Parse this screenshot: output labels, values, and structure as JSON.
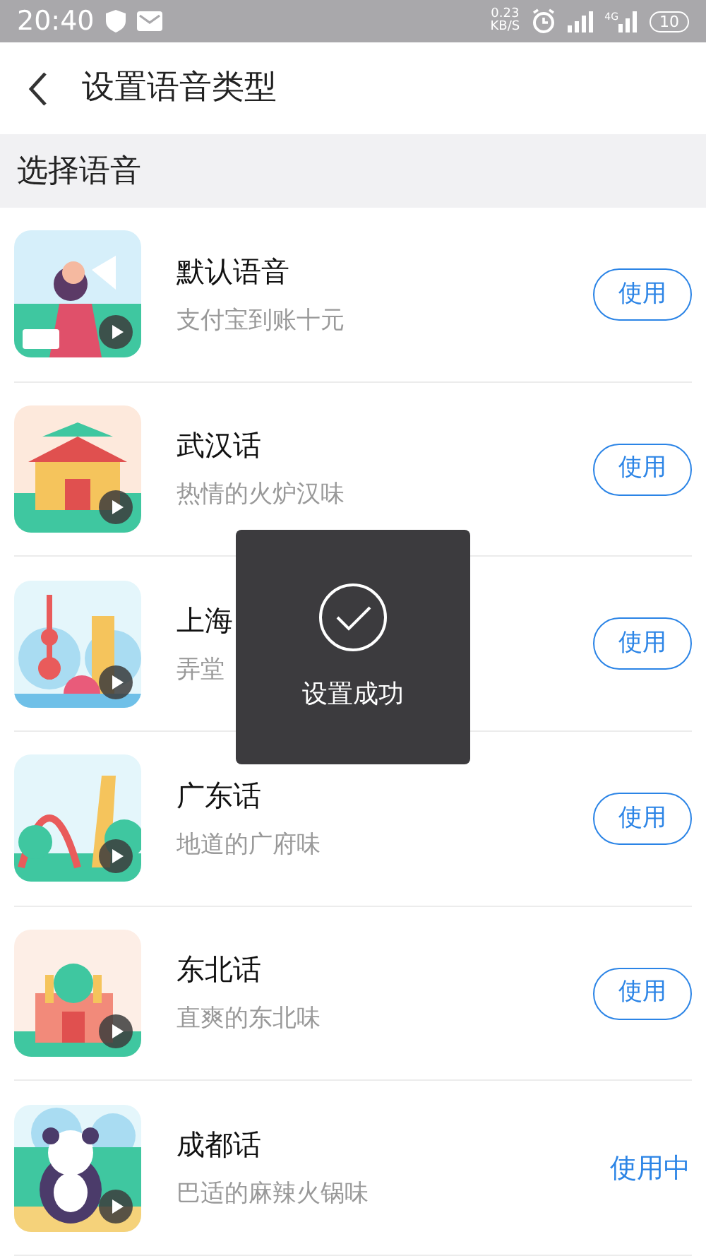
{
  "status_bar": {
    "time": "20:40",
    "net_speed": "0.23",
    "net_unit": "KB/S",
    "network": "4G",
    "battery": "10"
  },
  "header": {
    "title": "设置语音类型"
  },
  "section": {
    "title": "选择语音"
  },
  "voices": [
    {
      "title": "默认语音",
      "subtitle": "支付宝到账十元",
      "action": "使用",
      "selected": false
    },
    {
      "title": "武汉话",
      "subtitle": "热情的火炉汉味",
      "action": "使用",
      "selected": false
    },
    {
      "title": "上海",
      "subtitle": "弄堂",
      "action": "使用",
      "selected": false
    },
    {
      "title": "广东话",
      "subtitle": "地道的广府味",
      "action": "使用",
      "selected": false
    },
    {
      "title": "东北话",
      "subtitle": "直爽的东北味",
      "action": "使用",
      "selected": false
    },
    {
      "title": "成都话",
      "subtitle": "巴适的麻辣火锅味",
      "action": "使用中",
      "selected": true
    }
  ],
  "toast": {
    "message": "设置成功"
  }
}
